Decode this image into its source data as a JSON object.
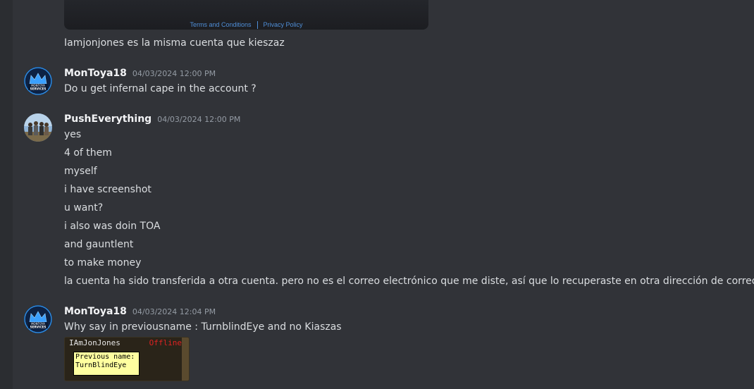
{
  "embed": {
    "terms_label": "Terms and Conditions",
    "privacy_label": "Privacy Policy"
  },
  "continuation_message": "Iamjonjones es la misma cuenta que kieszaz",
  "messages": [
    {
      "author": "MonToya18",
      "timestamp": "04/03/2024 12:00 PM",
      "avatar": "montoya-services-logo",
      "lines": [
        "Do u get infernal cape in the account ?"
      ]
    },
    {
      "author": "PushEverything",
      "timestamp": "04/03/2024 12:00 PM",
      "avatar": "group-photo",
      "lines": [
        "yes",
        "4 of them",
        "myself",
        "i have screenshot",
        "u want?",
        "i also was doin TOA",
        "and gauntlent",
        "to make money",
        "la cuenta ha sido transferida a otra cuenta. pero no es el correo electrónico que me diste, así que lo recuperaste en otra dirección de correo electrónico"
      ]
    },
    {
      "author": "MonToya18",
      "timestamp": "04/03/2024 12:04 PM",
      "avatar": "montoya-services-logo",
      "lines": [
        "Why say in previousname : TurnblindEye and no Kiaszas"
      ],
      "attachment": {
        "player_name": "IAmJonJones",
        "status": "Offline",
        "tooltip_line1": "Previous name:",
        "tooltip_line2": "TurnBlindEye"
      }
    }
  ],
  "avatar_logo_text": [
    "MONTOYA",
    "SERVICES"
  ]
}
